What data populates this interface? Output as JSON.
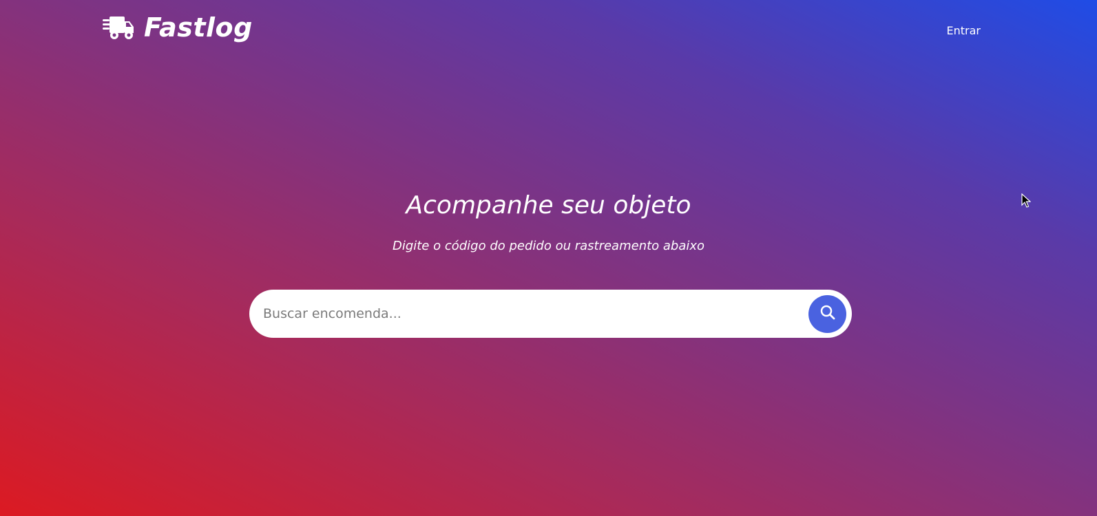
{
  "header": {
    "brand_name": "Fastlog",
    "logo_icon": "truck-icon",
    "login_label": "Entrar"
  },
  "hero": {
    "title": "Acompanhe seu objeto",
    "subtitle": "Digite o código do pedido ou rastreamento abaixo"
  },
  "search": {
    "placeholder": "Buscar encomenda...",
    "value": "",
    "button_icon": "search-icon"
  },
  "colors": {
    "gradient_top_right": "#1f4ce6",
    "gradient_bottom_left": "#dc1a22",
    "search_button": "#4a62e0"
  }
}
